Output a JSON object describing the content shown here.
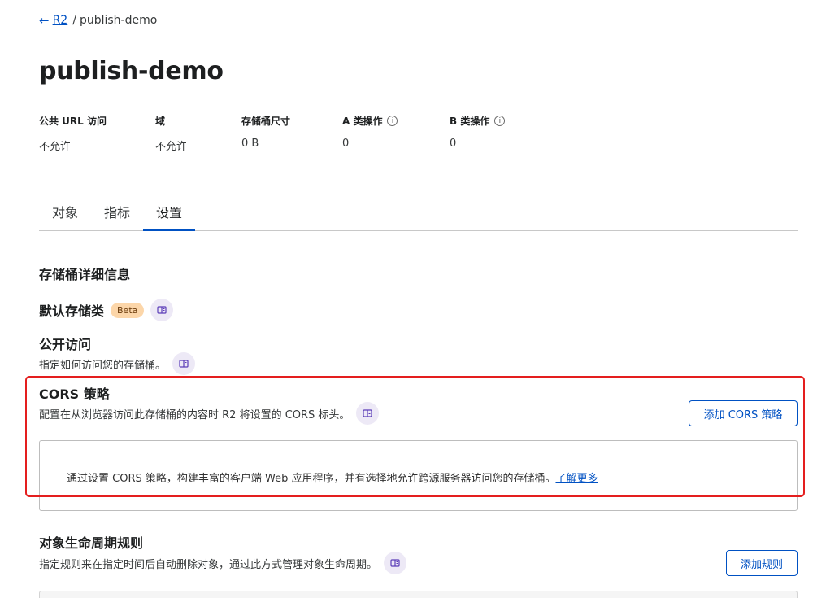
{
  "breadcrumb": {
    "back_icon": "arrow-left-icon",
    "parent": "R2",
    "separator": "/",
    "current": "publish-demo"
  },
  "page_title": "publish-demo",
  "stats": [
    {
      "label": "公共 URL 访问",
      "value": "不允许",
      "info": false
    },
    {
      "label": "域",
      "value": "不允许",
      "info": false
    },
    {
      "label": "存储桶尺寸",
      "value": "0 B",
      "info": false
    },
    {
      "label": "A 类操作",
      "value": "0",
      "info": true
    },
    {
      "label": "B 类操作",
      "value": "0",
      "info": true
    }
  ],
  "info_glyph": "i",
  "tabs": [
    {
      "label": "对象",
      "active": false
    },
    {
      "label": "指标",
      "active": false
    },
    {
      "label": "设置",
      "active": true
    }
  ],
  "bucket_details": {
    "title": "存储桶详细信息"
  },
  "default_storage": {
    "title": "默认存储类",
    "badge": "Beta"
  },
  "public_access": {
    "title": "公开访问",
    "description": "指定如何访问您的存储桶。"
  },
  "cors": {
    "title": "CORS 策略",
    "description": "配置在从浏览器访问此存储桶的内容时 R2 将设置的 CORS 标头。",
    "add_button": "添加 CORS 策略",
    "empty_text": "通过设置 CORS 策略，构建丰富的客户端 Web 应用程序，并有选择地允许跨源服务器访问您的存储桶。",
    "learn_more": "了解更多"
  },
  "lifecycle": {
    "title": "对象生命周期规则",
    "description": "指定规则来在指定时间后自动删除对象，通过此方式管理对象生命周期。",
    "add_button": "添加规则"
  },
  "colors": {
    "link": "#0051c3",
    "highlight": "#e41e1e",
    "beta_bg": "#fcd6a9",
    "doc_icon_bg": "#ede9f6"
  }
}
